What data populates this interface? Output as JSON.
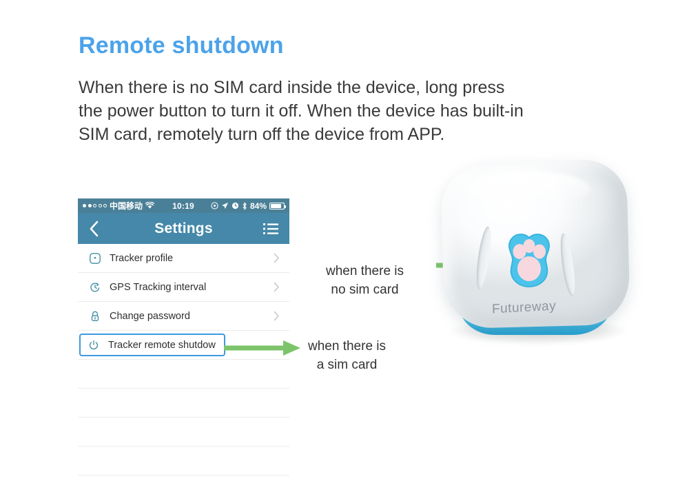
{
  "heading": "Remote shutdown",
  "body_lines": [
    "When there is no SIM card inside the device, long press",
    "the power button to turn it off. When the device has built-in",
    "SIM card, remotely turn off the device from APP."
  ],
  "phone": {
    "status_bar": {
      "carrier": "中国移动",
      "signal_dots_filled": 2,
      "signal_dots_total": 5,
      "wifi_icon": "wifi-icon",
      "time": "10:19",
      "icons": [
        "rotation-lock-icon",
        "location-arrow-icon",
        "alarm-clock-icon",
        "bluetooth-icon"
      ],
      "battery_percent": "84%",
      "battery_level": 84
    },
    "nav_bar": {
      "back_icon": "chevron-left-icon",
      "title": "Settings",
      "menu_icon": "list-menu-icon"
    },
    "list_items": [
      {
        "icon": "tracker-profile-icon",
        "label": "Tracker profile",
        "chevron": "chevron-right-icon",
        "highlighted": false
      },
      {
        "icon": "clock-interval-icon",
        "label": "GPS Tracking interval",
        "chevron": "chevron-right-icon",
        "highlighted": false
      },
      {
        "icon": "padlock-icon",
        "label": "Change password",
        "chevron": "chevron-right-icon",
        "highlighted": false
      },
      {
        "icon": "power-icon",
        "label": "Tracker remote shutdow",
        "chevron": "",
        "highlighted": true
      }
    ],
    "blank_rows": 4
  },
  "annotations": {
    "no_sim": {
      "line1": "when there is",
      "line2": "no sim card"
    },
    "has_sim": {
      "line1": "when there is",
      "line2": "a sim card"
    }
  },
  "device": {
    "brand": "Futureway",
    "button_icon": "paw-print-button"
  },
  "colors": {
    "heading_blue": "#4ba3ea",
    "nav_bar_blue": "#4588a9",
    "status_bar_blue": "#4a8097",
    "highlight_border": "#3d9ae0",
    "arrow_green": "#7cc36a",
    "icon_teal": "#3f8ea3",
    "device_accent_blue": "#35b3e0",
    "paw_blue": "#4cc3ea",
    "paw_pad_pink": "#f6d8de"
  }
}
